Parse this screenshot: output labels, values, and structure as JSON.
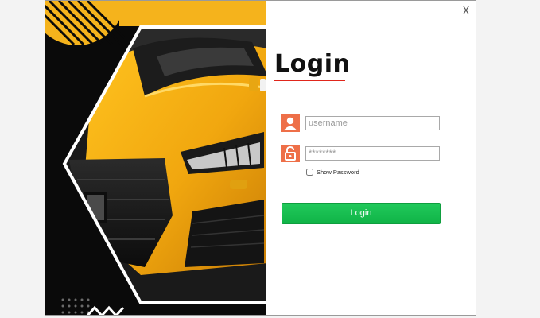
{
  "window": {
    "close_label": "X"
  },
  "form": {
    "title": "Login",
    "username": {
      "placeholder": "username",
      "value": "",
      "icon": "user-icon"
    },
    "password": {
      "placeholder": "********",
      "value": "",
      "icon": "lock-icon"
    },
    "show_password_label": "Show Password",
    "show_password_checked": false,
    "submit_label": "Login"
  },
  "colors": {
    "accent_orange": "#ee6f48",
    "underline_red": "#e0261b",
    "button_green": "#14bd4e",
    "car_yellow": "#f5b31c"
  }
}
